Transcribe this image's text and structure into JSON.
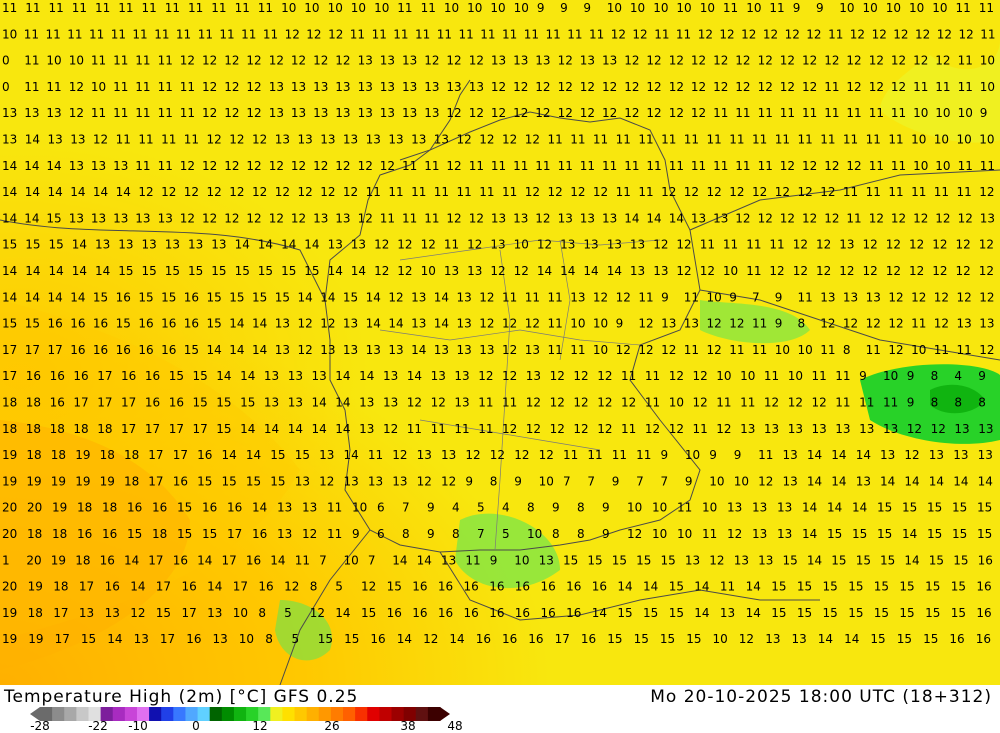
{
  "footer": {
    "title": "Temperature High (2m) [°C] GFS 0.25",
    "datetime": "Mo 20-10-2025 18:00 UTC (18+312)"
  },
  "colorbar": {
    "labels": [
      "-28",
      "-22",
      "-10",
      "0",
      "12",
      "26",
      "38",
      "48"
    ],
    "colors": [
      "#6b6b6b",
      "#8c8c8c",
      "#a8a8a8",
      "#c8c8c8",
      "#e0e0e0",
      "#7d1f9c",
      "#a82bc0",
      "#c845d8",
      "#e070f0",
      "#1010b0",
      "#2040e8",
      "#3878ff",
      "#50a8ff",
      "#60d0ff",
      "#006400",
      "#008c00",
      "#10b410",
      "#28d228",
      "#58e858",
      "#f0f020",
      "#ffe000",
      "#ffc800",
      "#ffb000",
      "#ff9800",
      "#ff7c00",
      "#ff6000",
      "#f83000",
      "#e00000",
      "#c00000",
      "#9c0000",
      "#800000",
      "#601010",
      "#3c0000"
    ]
  },
  "map": {
    "rows": [
      "11 11 11 11 11 11 11 11 11 11 11 11 10 10 10 10 10 11 11 10 10 10 10 9 9 9 10 10 10 10 10 11 10 11 9 9 10 10 10 10 10 11 11",
      "10 11 11 11 11 11 11 11 11 11 11 11 11 12 12 12 11 11 11 11 11 11 11 11 11 11 11 11 12 12 11 11 12 12 12 12 12 12 11 12 12 12 12 12 12 11",
      "0 11 10 10 11 11 11 11 12 12 12 12 12 12 12 12 13 13 13 12 12 12 13 13 13 12 13 13 12 12 12 12 12 12 12 12 12 12 12 12 12 12 12 11 10",
      "0 11 11 12 10 11 11 11 11 12 12 12 13 13 13 13 13 13 13 13 13 13 12 12 12 12 12 12 12 12 12 12 12 12 12 12 12 11 12 12 12 11 11 11 10",
      "13 13 13 12 11 11 11 11 11 12 12 12 13 13 13 13 13 13 13 13 12 12 12 12 12 12 12 12 12 12 12 12 11 11 11 11 11 11 11 11 11 10 10 10 9",
      "13 14 13 13 12 11 11 11 11 12 12 12 13 13 13 13 13 13 13 13 12 12 12 12 11 11 11 11 11 11 11 11 11 11 11 11 11 11 11 11 10 10 10 10",
      "14 14 14 13 13 13 11 11 12 12 12 12 12 12 12 12 12 12 11 11 12 11 11 11 11 11 11 11 11 11 11 11 11 11 11 12 12 12 12 11 11 10 10 11 11",
      "14 14 14 14 14 14 12 12 12 12 12 12 12 12 12 12 11 11 11 11 11 11 11 12 12 12 12 11 11 12 12 12 12 12 12 12 12 11 11 11 11 11 11 12",
      "14 14 15 13 13 13 13 13 12 12 12 12 12 12 13 13 12 11 11 11 12 12 13 13 12 13 13 13 14 14 14 13 13 12 12 12 12 12 11 12 12 12 12 12 13",
      "15 15 15 14 13 13 13 13 13 13 14 14 14 14 13 13 12 12 12 11 12 13 10 12 13 13 13 13 12 12 11 11 11 11 12 12 13 12 12 12 12 12 12",
      "14 14 14 14 14 15 15 15 15 15 15 15 15 15 14 14 12 12 10 13 13 12 12 14 14 14 14 13 13 12 12 10 11 12 12 12 12 12 12 12 12 12 12",
      "14 14 14 14 15 16 15 15 16 15 15 15 15 14 14 15 14 12 13 14 13 12 11 11 11 13 12 12 11 9 11 10 9 7 9 11 13 13 13 12 12 12 12 12",
      "15 15 16 16 16 15 16 16 16 15 14 14 13 12 12 13 14 14 13 14 13 12 12 12 11 10 10 9 12 13 13 12 12 11 9 8 12 12 12 12 11 12 13 13",
      "17 17 17 16 16 16 16 16 15 14 14 14 13 12 13 13 13 13 14 13 13 13 12 13 11 11 10 12 12 12 11 12 11 11 10 10 11 8 11 12 10 11 11 12",
      "17 16 16 16 17 16 16 15 15 14 14 13 13 13 14 14 13 14 13 13 12 12 13 12 12 12 11 11 12 12 10 10 11 10 11 11 9 10 9 8 4 9",
      "18 18 16 17 17 17 16 16 15 15 15 13 13 14 14 13 13 12 12 13 11 11 12 12 12 12 12 11 10 12 11 11 12 12 12 11 11 11 9 8 8 8",
      "18 18 18 18 18 17 17 17 17 15 14 14 14 14 14 13 12 11 11 11 11 12 12 12 12 12 11 12 12 11 12 13 13 13 13 13 13 13 12 12 13 13",
      "19 18 18 19 18 18 17 17 16 14 14 15 15 13 14 11 12 13 13 12 12 12 12 11 11 11 11 9 10 9 9 11 13 14 14 14 13 12 13 13 13",
      "19 19 19 19 19 18 17 16 15 15 15 15 13 12 13 13 13 12 12 9 8 9 10 7 7 9 7 7 9 10 10 12 13 14 14 13 14 14 14 14 14",
      "20 20 19 18 18 16 16 15 16 16 14 13 13 11 10 6 7 9 4 5 4 8 9 8 9 10 10 11 10 13 13 13 14 14 14 15 15 15 15 15",
      "20 18 18 16 16 15 18 15 15 17 16 13 12 11 9 6 8 9 8 7 5 10 8 8 9 12 10 10 11 12 13 13 14 15 15 15 14 15 15 15",
      "1 20 19 18 16 14 17 16 14 17 16 14 11 7 10 7 14 14 13 11 9 10 13 15 15 15 15 15 13 12 13 13 15 14 15 15 15 14 15 15 16",
      "20 19 18 17 16 14 17 16 14 17 16 12 8 5 12 15 16 16 16 16 16 16 16 16 14 14 15 14 11 14 15 15 15 15 15 15 15 15 16",
      "19 18 17 13 13 12 15 17 13 10 8 5 12 14 15 16 16 16 16 16 16 16 16 14 15 15 15 14 13 14 15 15 15 15 15 15 15 15 16",
      "19 19 17 15 14 13 17 16 13 10 8 5 15 15 16 14 12 14 16 16 16 17 16 15 15 15 15 10 12 13 13 14 14 15 15 15 16 16"
    ]
  }
}
